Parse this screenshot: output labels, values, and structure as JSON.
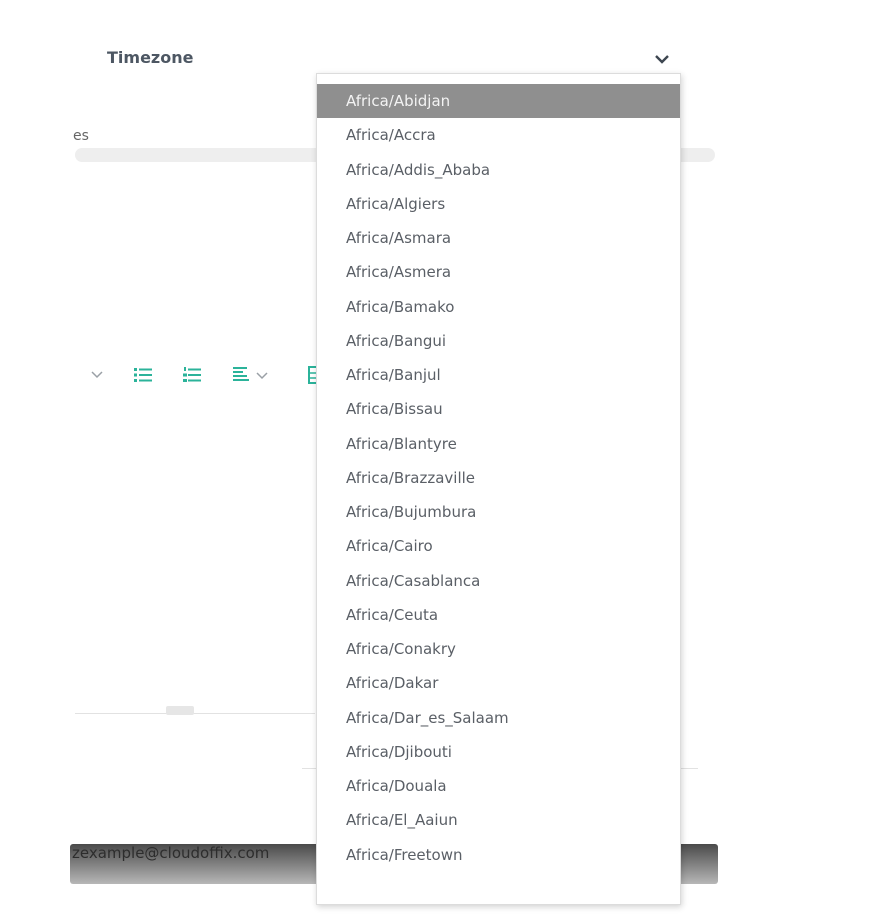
{
  "timezone": {
    "label": "Timezone",
    "options": [
      "Africa/Abidjan",
      "Africa/Accra",
      "Africa/Addis_Ababa",
      "Africa/Algiers",
      "Africa/Asmara",
      "Africa/Asmera",
      "Africa/Bamako",
      "Africa/Bangui",
      "Africa/Banjul",
      "Africa/Bissau",
      "Africa/Blantyre",
      "Africa/Brazzaville",
      "Africa/Bujumbura",
      "Africa/Cairo",
      "Africa/Casablanca",
      "Africa/Ceuta",
      "Africa/Conakry",
      "Africa/Dakar",
      "Africa/Dar_es_Salaam",
      "Africa/Djibouti",
      "Africa/Douala",
      "Africa/El_Aaiun",
      "Africa/Freetown"
    ],
    "selected_index": 0
  },
  "background": {
    "partial_text": "es",
    "email": "zexample@cloudoffix.com"
  },
  "colors": {
    "selected_bg": "#8f8f8f",
    "toolbar_icon": "#2bb39a"
  },
  "icons": [
    "chevron-down-icon",
    "bulleted-list-icon",
    "numbered-list-icon",
    "align-icon",
    "table-icon"
  ]
}
